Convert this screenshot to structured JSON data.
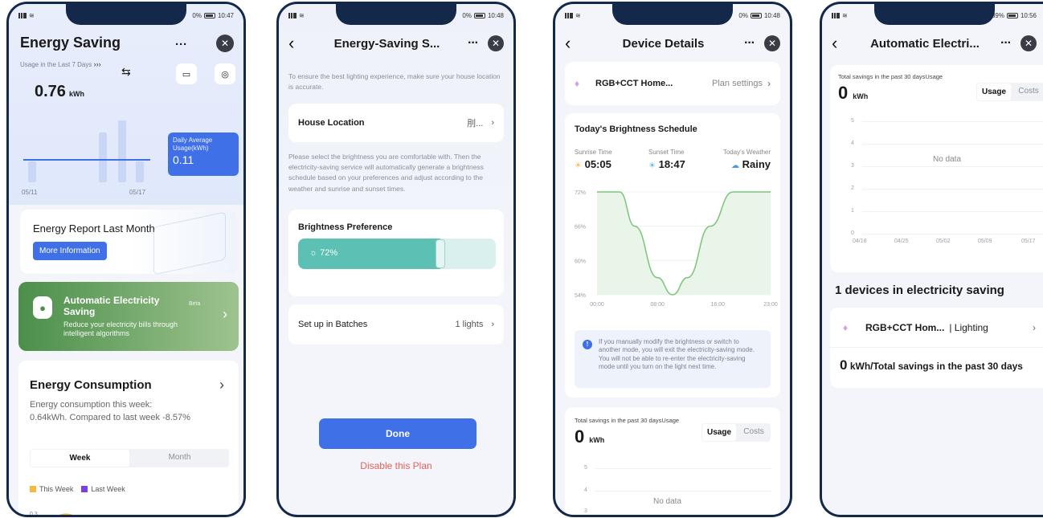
{
  "phone1": {
    "status_time": "10:47",
    "status_batt": "0%",
    "title": "Energy Saving",
    "usage_label": "Usage in the Last 7 Days",
    "usage_value": "0.76",
    "usage_unit": "kWh",
    "chart_dates": [
      "05/11",
      "05/17"
    ],
    "tooltip_label": "Daily Average Usage(kWh)",
    "tooltip_value": "0.11",
    "report_title": "Energy Report Last Month",
    "report_button": "More Information",
    "auto_title": "Automatic Electricity Saving",
    "auto_badge": "Beta",
    "auto_desc": "Reduce your electricity bills through intelligent algorithms",
    "consumption_title": "Energy Consumption",
    "consumption_desc": "Energy consumption this week: 0.64kWh. Compared to last week -8.57%",
    "toggle_week": "Week",
    "toggle_month": "Month",
    "legend_this": "This Week",
    "legend_last": "Last Week",
    "axis_first": "0.3",
    "colors": {
      "this_week": "#f5b841",
      "last_week": "#7b3fe4",
      "accent": "#3f70e8"
    }
  },
  "phone2": {
    "status_time": "10:48",
    "status_batt": "0%",
    "title": "Energy-Saving S...",
    "intro": "To ensure the best lighting experience, make sure your house location is accurate.",
    "house_label": "House Location",
    "house_value": "刖...",
    "brightness_desc": "Please select the brightness you are comfortable with. Then the electricity-saving service will automatically generate a brightness schedule based on your preferences and adjust according to the weather and sunrise and sunset times.",
    "pref_label": "Brightness Preference",
    "pref_value": "72%",
    "pref_level": 0.72,
    "batch_label": "Set up in Batches",
    "batch_value": "1 lights",
    "done": "Done",
    "disable": "Disable this Plan"
  },
  "phone3": {
    "status_time": "10:48",
    "status_batt": "0%",
    "title": "Device Details",
    "device_name": "RGB+CCT Home...",
    "plan_settings": "Plan settings",
    "schedule_title": "Today's Brightness Schedule",
    "sunrise_label": "Sunrise Time",
    "sunrise_value": "05:05",
    "sunset_label": "Sunset Time",
    "sunset_value": "18:47",
    "weather_label": "Today's Weather",
    "weather_value": "Rainy",
    "y_ticks": [
      "72%",
      "66%",
      "60%",
      "54%"
    ],
    "x_ticks": [
      "00:00",
      "08:00",
      "16:00",
      "23:00"
    ],
    "notice": "If you manually modify the brightness or switch to another mode, you will exit the electricity-saving mode. You will not be able to re-enter the electricity-saving mode until you turn on the light next time.",
    "savings_label": "Total savings in the past 30 daysUsage",
    "savings_value": "0",
    "savings_unit": "kWh",
    "tog_usage": "Usage",
    "tog_costs": "Costs",
    "mini_ticks": [
      "5",
      "4",
      "3"
    ],
    "no_data": "No data"
  },
  "phone4": {
    "status_time": "10:56",
    "status_batt": "89%",
    "title": "Automatic Electri...",
    "savings_label": "Total savings in the past 30 daysUsage",
    "savings_value": "0",
    "savings_unit": "kWh",
    "tog_usage": "Usage",
    "tog_costs": "Costs",
    "y_ticks": [
      "5",
      "4",
      "3",
      "2",
      "1",
      "0"
    ],
    "x_ticks": [
      "04/18",
      "04/25",
      "05/02",
      "05/09",
      "05/17"
    ],
    "no_data": "No data",
    "devices_title": "1 devices in electricity saving",
    "device_name": "RGB+CCT Hom...",
    "device_type": "| Lighting",
    "total_value": "0",
    "total_text": "kWh/Total savings in the past 30 days"
  },
  "chart_data": [
    {
      "type": "line",
      "x": [
        "00:00",
        "08:00",
        "16:00",
        "23:00"
      ],
      "y_ticks": [
        "72%",
        "66%",
        "60%",
        "54%"
      ],
      "series": [
        {
          "values": [
            {
              "x": "00:00",
              "y": 72
            },
            {
              "x": "03:00",
              "y": 72
            },
            {
              "x": "05:00",
              "y": 66
            },
            {
              "x": "08:00",
              "y": 57
            },
            {
              "x": "10:00",
              "y": 54
            },
            {
              "x": "12:00",
              "y": 57
            },
            {
              "x": "15:00",
              "y": 66
            },
            {
              "x": "18:00",
              "y": 72
            },
            {
              "x": "23:00",
              "y": 72
            }
          ]
        }
      ],
      "ylim": [
        54,
        72
      ]
    }
  ]
}
